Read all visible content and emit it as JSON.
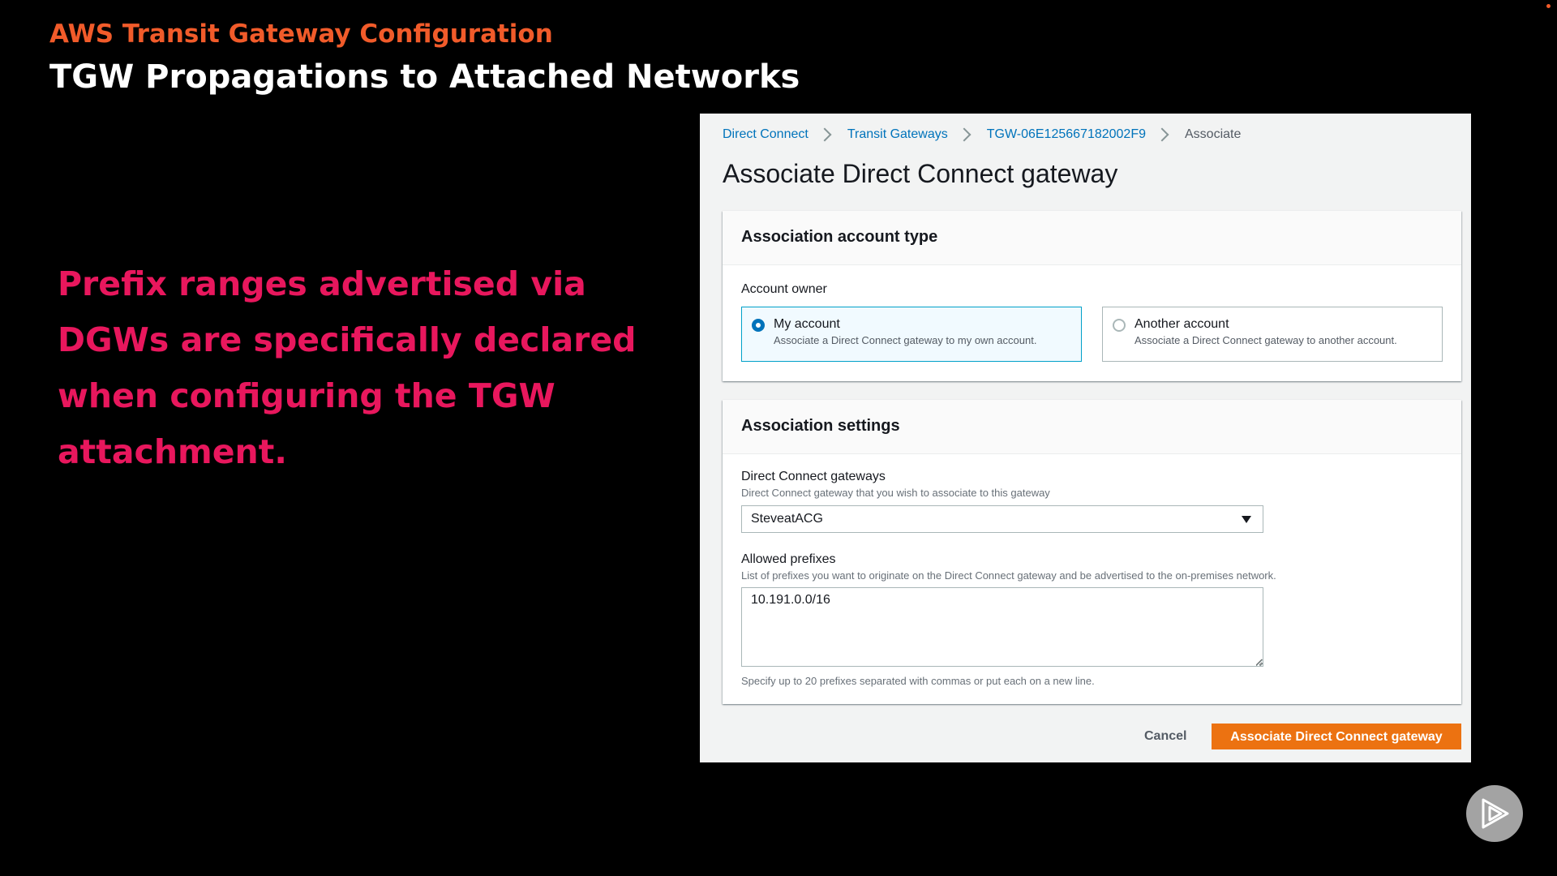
{
  "slide": {
    "kicker": "AWS Transit Gateway Configuration",
    "title": "TGW Propagations to Attached Networks",
    "body": "Prefix ranges advertised via DGWs are specifically declared when configuring the TGW attachment."
  },
  "console": {
    "breadcrumb": [
      {
        "label": "Direct Connect",
        "link": true
      },
      {
        "label": "Transit Gateways",
        "link": true
      },
      {
        "label": "TGW-06E125667182002F9",
        "link": true
      },
      {
        "label": "Associate",
        "link": false
      }
    ],
    "heading": "Associate Direct Connect gateway",
    "account_type": {
      "title": "Association account type",
      "field_label": "Account owner",
      "options": [
        {
          "label": "My account",
          "description": "Associate a Direct Connect gateway to my own account.",
          "selected": true
        },
        {
          "label": "Another account",
          "description": "Associate a Direct Connect gateway to another account.",
          "selected": false
        }
      ]
    },
    "settings": {
      "title": "Association settings",
      "gateways_label": "Direct Connect gateways",
      "gateways_description": "Direct Connect gateway that you wish to associate to this gateway",
      "gateways_value": "SteveatACG",
      "prefixes_label": "Allowed prefixes",
      "prefixes_description": "List of prefixes you want to originate on the Direct Connect gateway and be advertised to the on-premises network.",
      "prefixes_value": "10.191.0.0/16",
      "prefixes_hint": "Specify up to 20 prefixes separated with commas or put each on a new line."
    },
    "actions": {
      "cancel_label": "Cancel",
      "submit_label": "Associate Direct Connect gateway"
    }
  },
  "colors": {
    "kicker": "#f15b2a",
    "body_text": "#e8175d",
    "primary_button": "#ec7211",
    "link": "#0073bb",
    "selected_tile_border": "#00a1c9"
  },
  "icons": {
    "breadcrumb_separator": "chevron-right-icon",
    "select_caret": "caret-down-icon",
    "player": "play-icon"
  }
}
